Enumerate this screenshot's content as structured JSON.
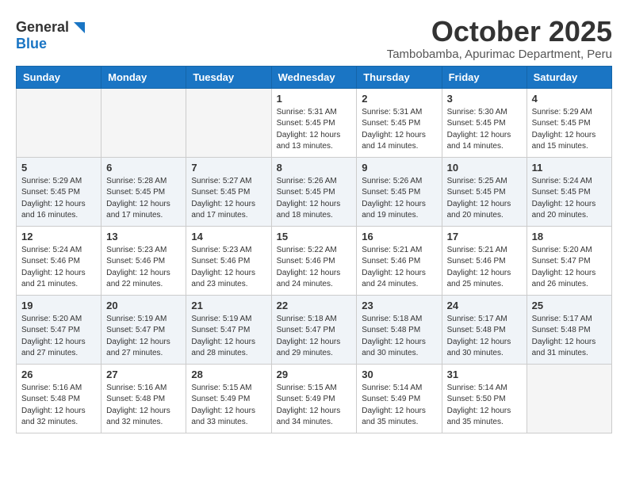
{
  "header": {
    "logo_line1": "General",
    "logo_line2": "Blue",
    "month": "October 2025",
    "location": "Tambobamba, Apurimac Department, Peru"
  },
  "days_of_week": [
    "Sunday",
    "Monday",
    "Tuesday",
    "Wednesday",
    "Thursday",
    "Friday",
    "Saturday"
  ],
  "weeks": [
    [
      {
        "day": "",
        "info": ""
      },
      {
        "day": "",
        "info": ""
      },
      {
        "day": "",
        "info": ""
      },
      {
        "day": "1",
        "info": "Sunrise: 5:31 AM\nSunset: 5:45 PM\nDaylight: 12 hours\nand 13 minutes."
      },
      {
        "day": "2",
        "info": "Sunrise: 5:31 AM\nSunset: 5:45 PM\nDaylight: 12 hours\nand 14 minutes."
      },
      {
        "day": "3",
        "info": "Sunrise: 5:30 AM\nSunset: 5:45 PM\nDaylight: 12 hours\nand 14 minutes."
      },
      {
        "day": "4",
        "info": "Sunrise: 5:29 AM\nSunset: 5:45 PM\nDaylight: 12 hours\nand 15 minutes."
      }
    ],
    [
      {
        "day": "5",
        "info": "Sunrise: 5:29 AM\nSunset: 5:45 PM\nDaylight: 12 hours\nand 16 minutes."
      },
      {
        "day": "6",
        "info": "Sunrise: 5:28 AM\nSunset: 5:45 PM\nDaylight: 12 hours\nand 17 minutes."
      },
      {
        "day": "7",
        "info": "Sunrise: 5:27 AM\nSunset: 5:45 PM\nDaylight: 12 hours\nand 17 minutes."
      },
      {
        "day": "8",
        "info": "Sunrise: 5:26 AM\nSunset: 5:45 PM\nDaylight: 12 hours\nand 18 minutes."
      },
      {
        "day": "9",
        "info": "Sunrise: 5:26 AM\nSunset: 5:45 PM\nDaylight: 12 hours\nand 19 minutes."
      },
      {
        "day": "10",
        "info": "Sunrise: 5:25 AM\nSunset: 5:45 PM\nDaylight: 12 hours\nand 20 minutes."
      },
      {
        "day": "11",
        "info": "Sunrise: 5:24 AM\nSunset: 5:45 PM\nDaylight: 12 hours\nand 20 minutes."
      }
    ],
    [
      {
        "day": "12",
        "info": "Sunrise: 5:24 AM\nSunset: 5:46 PM\nDaylight: 12 hours\nand 21 minutes."
      },
      {
        "day": "13",
        "info": "Sunrise: 5:23 AM\nSunset: 5:46 PM\nDaylight: 12 hours\nand 22 minutes."
      },
      {
        "day": "14",
        "info": "Sunrise: 5:23 AM\nSunset: 5:46 PM\nDaylight: 12 hours\nand 23 minutes."
      },
      {
        "day": "15",
        "info": "Sunrise: 5:22 AM\nSunset: 5:46 PM\nDaylight: 12 hours\nand 24 minutes."
      },
      {
        "day": "16",
        "info": "Sunrise: 5:21 AM\nSunset: 5:46 PM\nDaylight: 12 hours\nand 24 minutes."
      },
      {
        "day": "17",
        "info": "Sunrise: 5:21 AM\nSunset: 5:46 PM\nDaylight: 12 hours\nand 25 minutes."
      },
      {
        "day": "18",
        "info": "Sunrise: 5:20 AM\nSunset: 5:47 PM\nDaylight: 12 hours\nand 26 minutes."
      }
    ],
    [
      {
        "day": "19",
        "info": "Sunrise: 5:20 AM\nSunset: 5:47 PM\nDaylight: 12 hours\nand 27 minutes."
      },
      {
        "day": "20",
        "info": "Sunrise: 5:19 AM\nSunset: 5:47 PM\nDaylight: 12 hours\nand 27 minutes."
      },
      {
        "day": "21",
        "info": "Sunrise: 5:19 AM\nSunset: 5:47 PM\nDaylight: 12 hours\nand 28 minutes."
      },
      {
        "day": "22",
        "info": "Sunrise: 5:18 AM\nSunset: 5:47 PM\nDaylight: 12 hours\nand 29 minutes."
      },
      {
        "day": "23",
        "info": "Sunrise: 5:18 AM\nSunset: 5:48 PM\nDaylight: 12 hours\nand 30 minutes."
      },
      {
        "day": "24",
        "info": "Sunrise: 5:17 AM\nSunset: 5:48 PM\nDaylight: 12 hours\nand 30 minutes."
      },
      {
        "day": "25",
        "info": "Sunrise: 5:17 AM\nSunset: 5:48 PM\nDaylight: 12 hours\nand 31 minutes."
      }
    ],
    [
      {
        "day": "26",
        "info": "Sunrise: 5:16 AM\nSunset: 5:48 PM\nDaylight: 12 hours\nand 32 minutes."
      },
      {
        "day": "27",
        "info": "Sunrise: 5:16 AM\nSunset: 5:48 PM\nDaylight: 12 hours\nand 32 minutes."
      },
      {
        "day": "28",
        "info": "Sunrise: 5:15 AM\nSunset: 5:49 PM\nDaylight: 12 hours\nand 33 minutes."
      },
      {
        "day": "29",
        "info": "Sunrise: 5:15 AM\nSunset: 5:49 PM\nDaylight: 12 hours\nand 34 minutes."
      },
      {
        "day": "30",
        "info": "Sunrise: 5:14 AM\nSunset: 5:49 PM\nDaylight: 12 hours\nand 35 minutes."
      },
      {
        "day": "31",
        "info": "Sunrise: 5:14 AM\nSunset: 5:50 PM\nDaylight: 12 hours\nand 35 minutes."
      },
      {
        "day": "",
        "info": ""
      }
    ]
  ]
}
